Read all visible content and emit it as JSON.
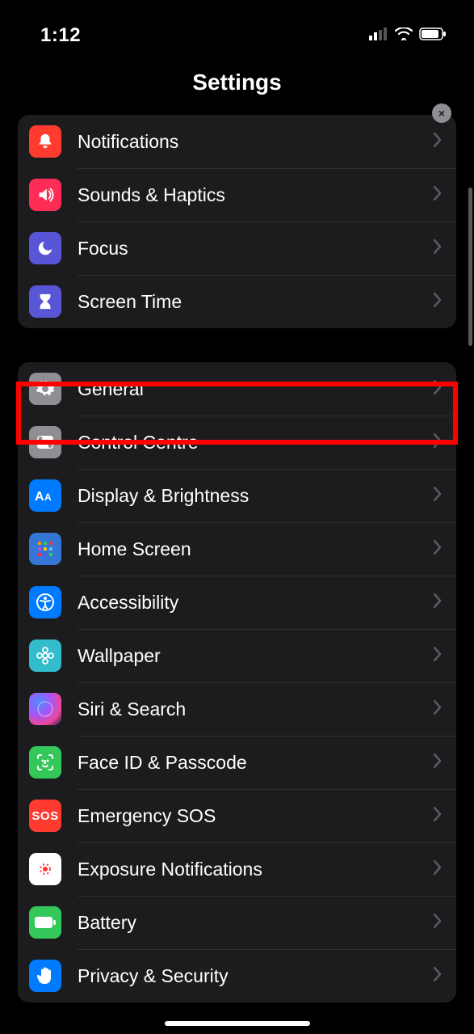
{
  "status": {
    "time": "1:12"
  },
  "header": {
    "title": "Settings"
  },
  "close_label": "×",
  "groups": [
    {
      "items": [
        {
          "id": "notifications",
          "label": "Notifications",
          "icon": "bell-icon",
          "bg": "bg-red"
        },
        {
          "id": "sounds-haptics",
          "label": "Sounds & Haptics",
          "icon": "speaker-icon",
          "bg": "bg-pink"
        },
        {
          "id": "focus",
          "label": "Focus",
          "icon": "moon-icon",
          "bg": "bg-indigo"
        },
        {
          "id": "screen-time",
          "label": "Screen Time",
          "icon": "hourglass-icon",
          "bg": "bg-indigo"
        }
      ]
    },
    {
      "items": [
        {
          "id": "general",
          "label": "General",
          "icon": "gear-icon",
          "bg": "bg-gray",
          "highlighted": true
        },
        {
          "id": "control-centre",
          "label": "Control Centre",
          "icon": "toggles-icon",
          "bg": "bg-gray"
        },
        {
          "id": "display-brightness",
          "label": "Display & Brightness",
          "icon": "text-size-icon",
          "bg": "bg-blue"
        },
        {
          "id": "home-screen",
          "label": "Home Screen",
          "icon": "grid-icon",
          "bg": "bg-home"
        },
        {
          "id": "accessibility",
          "label": "Accessibility",
          "icon": "accessibility-icon",
          "bg": "bg-blue"
        },
        {
          "id": "wallpaper",
          "label": "Wallpaper",
          "icon": "flower-icon",
          "bg": "bg-teal"
        },
        {
          "id": "siri-search",
          "label": "Siri & Search",
          "icon": "siri-icon",
          "bg": "bg-black"
        },
        {
          "id": "face-id-passcode",
          "label": "Face ID & Passcode",
          "icon": "faceid-icon",
          "bg": "bg-green"
        },
        {
          "id": "emergency-sos",
          "label": "Emergency SOS",
          "icon": "sos-icon",
          "bg": "bg-red"
        },
        {
          "id": "exposure-notifications",
          "label": "Exposure Notifications",
          "icon": "exposure-icon",
          "bg": "bg-white"
        },
        {
          "id": "battery",
          "label": "Battery",
          "icon": "battery-icon",
          "bg": "bg-green"
        },
        {
          "id": "privacy-security",
          "label": "Privacy & Security",
          "icon": "hand-icon",
          "bg": "bg-blue"
        }
      ]
    }
  ]
}
